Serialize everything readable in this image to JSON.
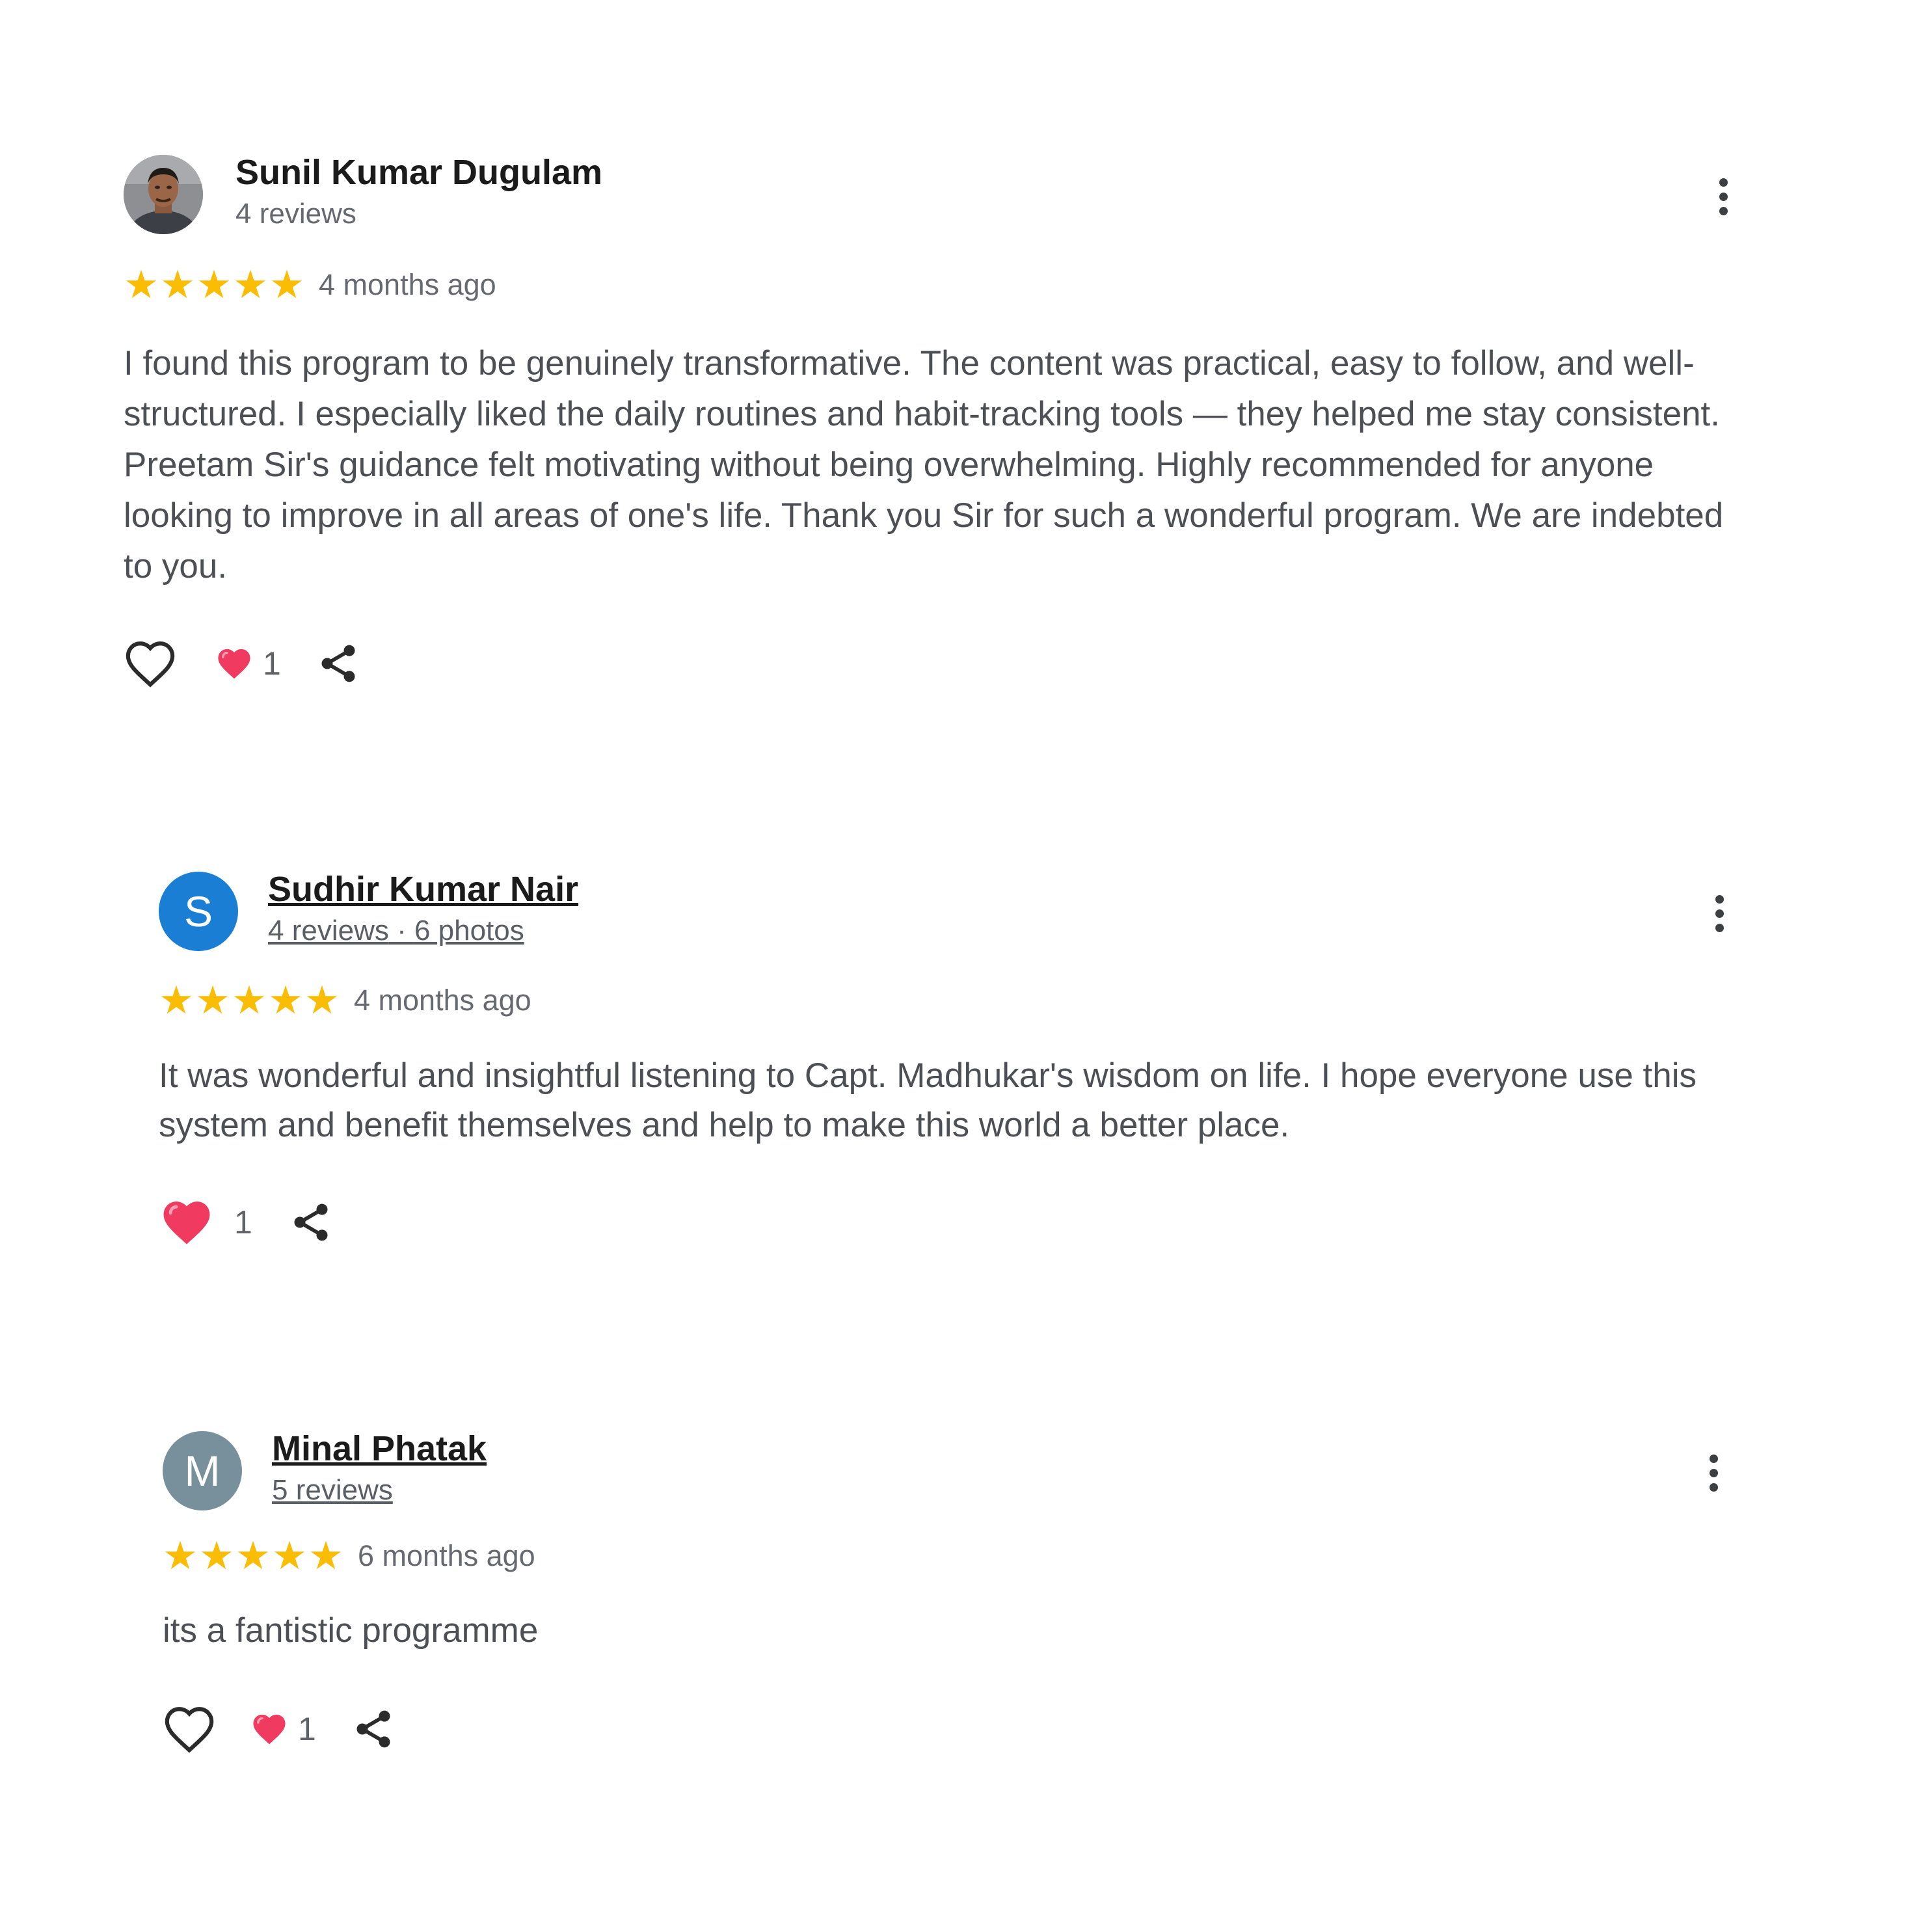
{
  "reviews": [
    {
      "name": "Sunil Kumar Dugulam",
      "meta": "4 reviews",
      "avatar_type": "photo",
      "rating": 5,
      "date": "4 months ago",
      "text": "I found this program to be genuinely transformative. The content was practical, easy to follow, and well-structured. I especially liked the daily routines and habit-tracking tools — they helped me stay consistent. Preetam Sir's guidance felt motivating without being overwhelming. Highly recommended for anyone looking to improve in all areas of one's life. Thank you Sir for such a wonderful program. We are indebted to you.",
      "reaction_count": "1",
      "icons": [
        "heart-outline-icon",
        "heart-filled-icon",
        "share-icon",
        "more-vert-icon"
      ]
    },
    {
      "name": "Sudhir Kumar Nair",
      "meta_reviews": "4 reviews",
      "meta_sep": " · ",
      "meta_photos": "6 photos",
      "avatar_letter": "S",
      "avatar_color": "#1a7fd4",
      "rating": 5,
      "date": "4 months ago",
      "text": "It was wonderful and insightful listening to Capt. Madhukar's wisdom on life. I hope everyone use this system and benefit themselves and help to make this world a better place.",
      "reaction_count": "1",
      "icons": [
        "heart-filled-icon",
        "share-icon",
        "more-vert-icon"
      ]
    },
    {
      "name": "Minal Phatak",
      "meta": "5 reviews",
      "avatar_letter": "M",
      "avatar_color": "#78909c",
      "rating": 5,
      "date": "6 months ago",
      "text": "its a fantistic programme",
      "reaction_count": "1",
      "icons": [
        "heart-outline-icon",
        "heart-filled-icon",
        "share-icon",
        "more-vert-icon"
      ]
    }
  ],
  "colors": {
    "star": "#fbbc04",
    "heart": "#f03a5f",
    "text": "#4c4f54",
    "meta": "#666a70"
  },
  "star_glyph": "★"
}
